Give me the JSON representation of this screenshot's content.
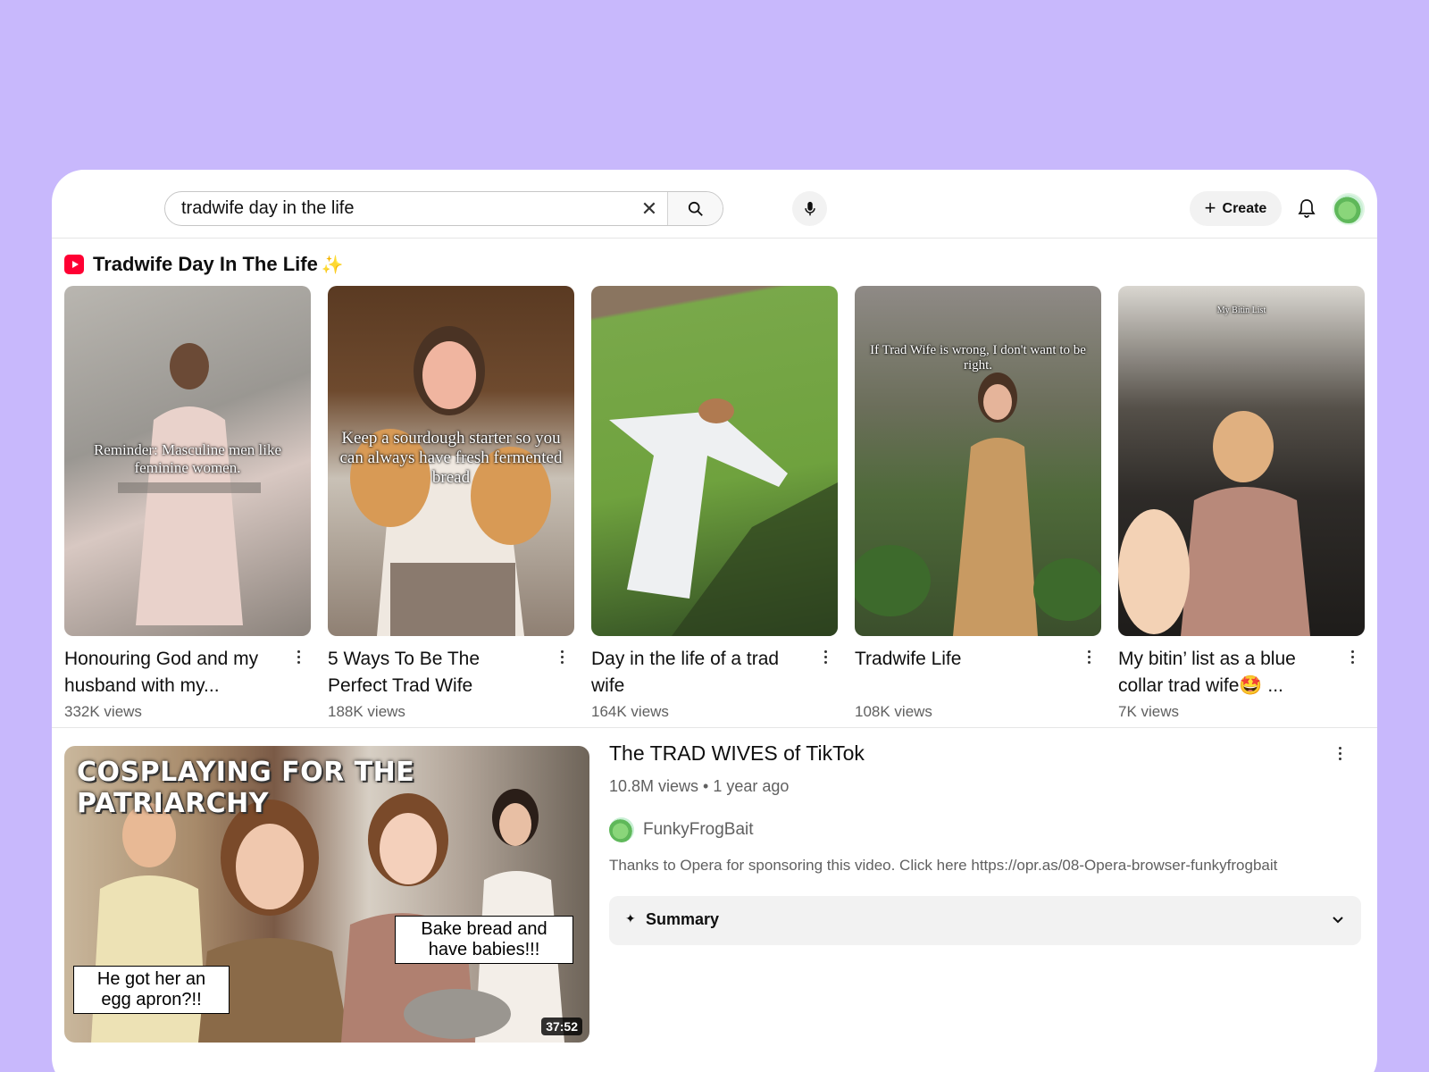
{
  "search": {
    "query": "tradwife day in the life",
    "clear_icon": "close-icon",
    "search_icon": "search-icon"
  },
  "header": {
    "create_label": "Create",
    "icons": [
      "microphone-icon",
      "bell-icon"
    ]
  },
  "shorts": {
    "title": "Tradwife Day In The Life",
    "title_emoji": "✨",
    "items": [
      {
        "title": "Honouring God and my husband with my...",
        "views": "332K views",
        "overlay": "Reminder: Masculine men like feminine women."
      },
      {
        "title": "5 Ways To Be The Perfect Trad Wife",
        "views": "188K views",
        "overlay": "Keep a sourdough starter so you can always have fresh fermented bread"
      },
      {
        "title": "Day in the life of a trad wife",
        "views": "164K views",
        "overlay": ""
      },
      {
        "title": "Tradwife Life",
        "views": "108K views",
        "overlay": "If Trad Wife is wrong, I don't want to be right."
      },
      {
        "title": "My bitin’ list as a blue collar trad wife🤩 ...",
        "views": "7K views",
        "overlay": "My Bitin List"
      }
    ]
  },
  "video": {
    "thumbnail_headline": "COSPLAYING FOR THE PATRIARCHY",
    "bubble_left": "He got her an egg apron?!!",
    "bubble_right": "Bake bread and have babies!!!",
    "duration": "37:52",
    "title": "The TRAD WIVES of TikTok",
    "meta": "10.8M views • 1 year ago",
    "channel": "FunkyFrogBait",
    "description": "Thanks to Opera for sponsoring this video. Click here https://opr.as/08-Opera-browser-funkyfrogbait",
    "summary_label": "Summary"
  },
  "colors": {
    "background": "#c8b8fc",
    "shorts_brand": "#ff0033"
  }
}
